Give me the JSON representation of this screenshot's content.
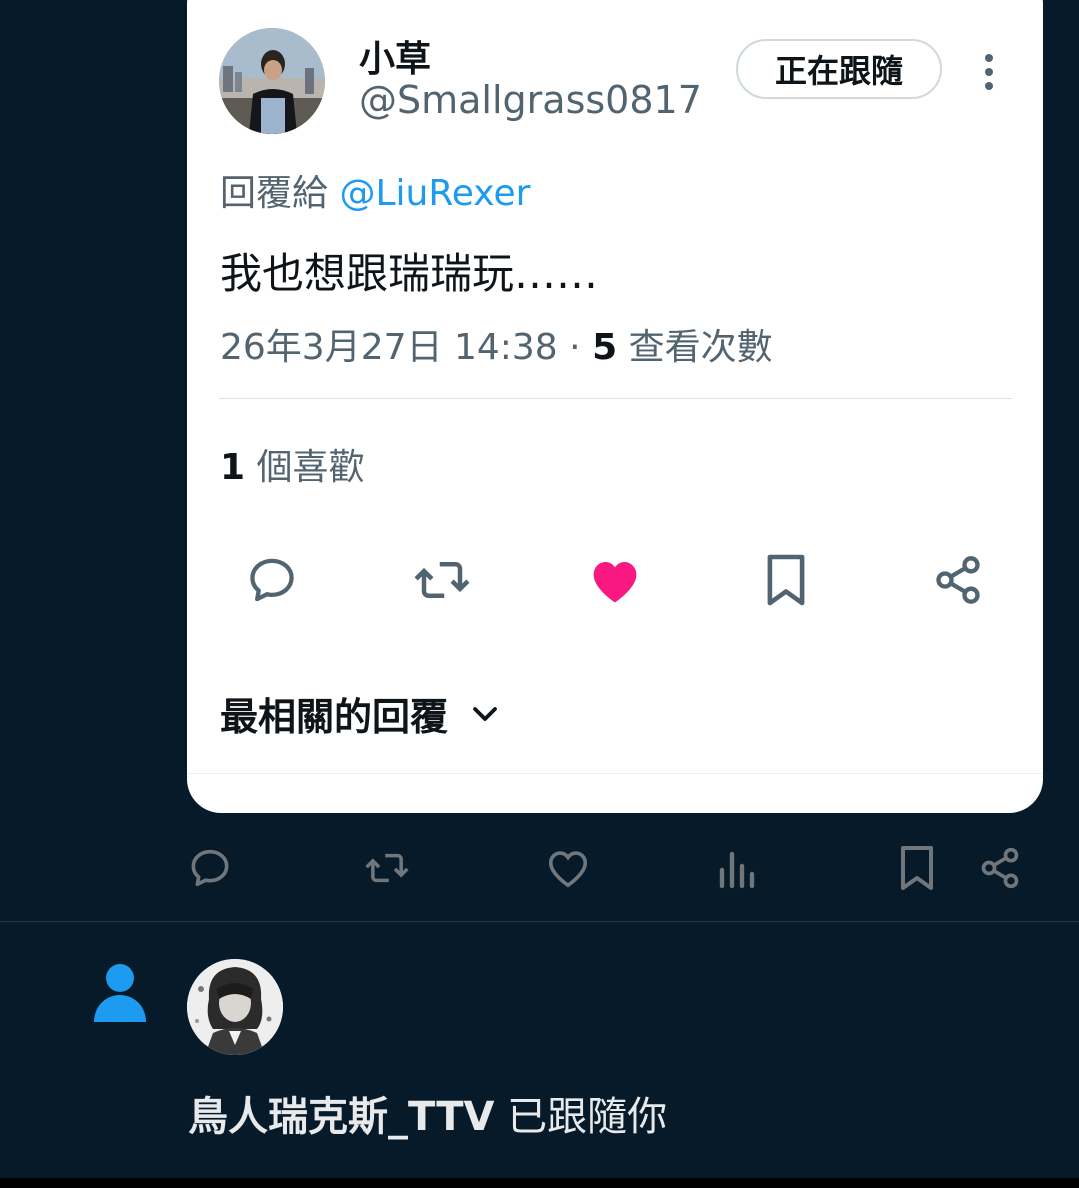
{
  "quoted_tweet": {
    "display_name": "小草",
    "handle": "@Smallgrass0817",
    "follow_button_label": "正在跟隨",
    "reply_prefix": "回覆給",
    "reply_mention": "@LiuRexer",
    "text": "我也想跟瑞瑞玩……",
    "timestamp": "26年3月27日 14:38",
    "separator": " · ",
    "views_count": "5",
    "views_label": "查看次數",
    "likes_count": "1",
    "likes_label": "個喜歡",
    "liked": true,
    "actions": [
      "reply-icon",
      "retweet-icon",
      "like-icon",
      "bookmark-icon",
      "share-icon"
    ],
    "replies_sort_label": "最相關的回覆"
  },
  "outer_tweet_actions": [
    "reply-icon",
    "retweet-icon",
    "like-icon",
    "views-icon",
    "bookmark-icon",
    "share-icon"
  ],
  "notification": {
    "type_icon": "person-icon",
    "follower_name": "鳥人瑞克斯_TTV",
    "action_text": " 已跟隨你"
  },
  "colors": {
    "background": "#061a29",
    "accent": "#1d9bf0",
    "like": "#f91880",
    "secondary_text": "#536471"
  }
}
